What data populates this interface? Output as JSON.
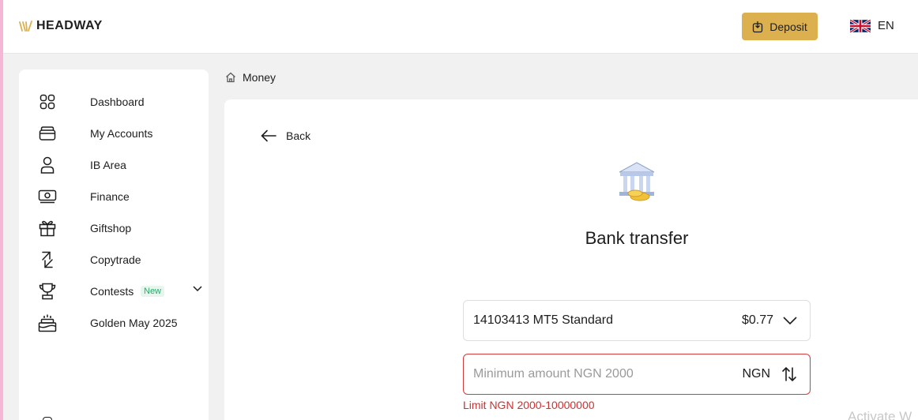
{
  "brand": {
    "name": "HEADWAY"
  },
  "header": {
    "deposit_label": "Deposit",
    "language": "EN"
  },
  "sidebar": {
    "items": [
      {
        "label": "Dashboard",
        "icon": "dashboard-grid-icon"
      },
      {
        "label": "My Accounts",
        "icon": "wallet-icon"
      },
      {
        "label": "IB Area",
        "icon": "user-icon"
      },
      {
        "label": "Finance",
        "icon": "money-icon"
      },
      {
        "label": "Giftshop",
        "icon": "gift-icon"
      },
      {
        "label": "Copytrade",
        "icon": "copy-arrows-icon"
      },
      {
        "label": "Contests",
        "icon": "trophy-icon",
        "badge": "New"
      },
      {
        "label": "Golden May 2025",
        "icon": "cake-icon"
      }
    ]
  },
  "breadcrumb": {
    "label": "Money"
  },
  "main": {
    "back_label": "Back",
    "title": "Bank transfer",
    "account": {
      "number_type": "14103413 MT5 Standard",
      "balance": "$0.77"
    },
    "amount": {
      "placeholder": "Minimum amount NGN 2000",
      "currency": "NGN"
    },
    "limit_text": "Limit NGN 2000-10000000"
  },
  "watermark": "Activate W",
  "colors": {
    "accent": "#dcb04e",
    "error": "#d43c3c",
    "badge_green": "#2aa86a"
  }
}
